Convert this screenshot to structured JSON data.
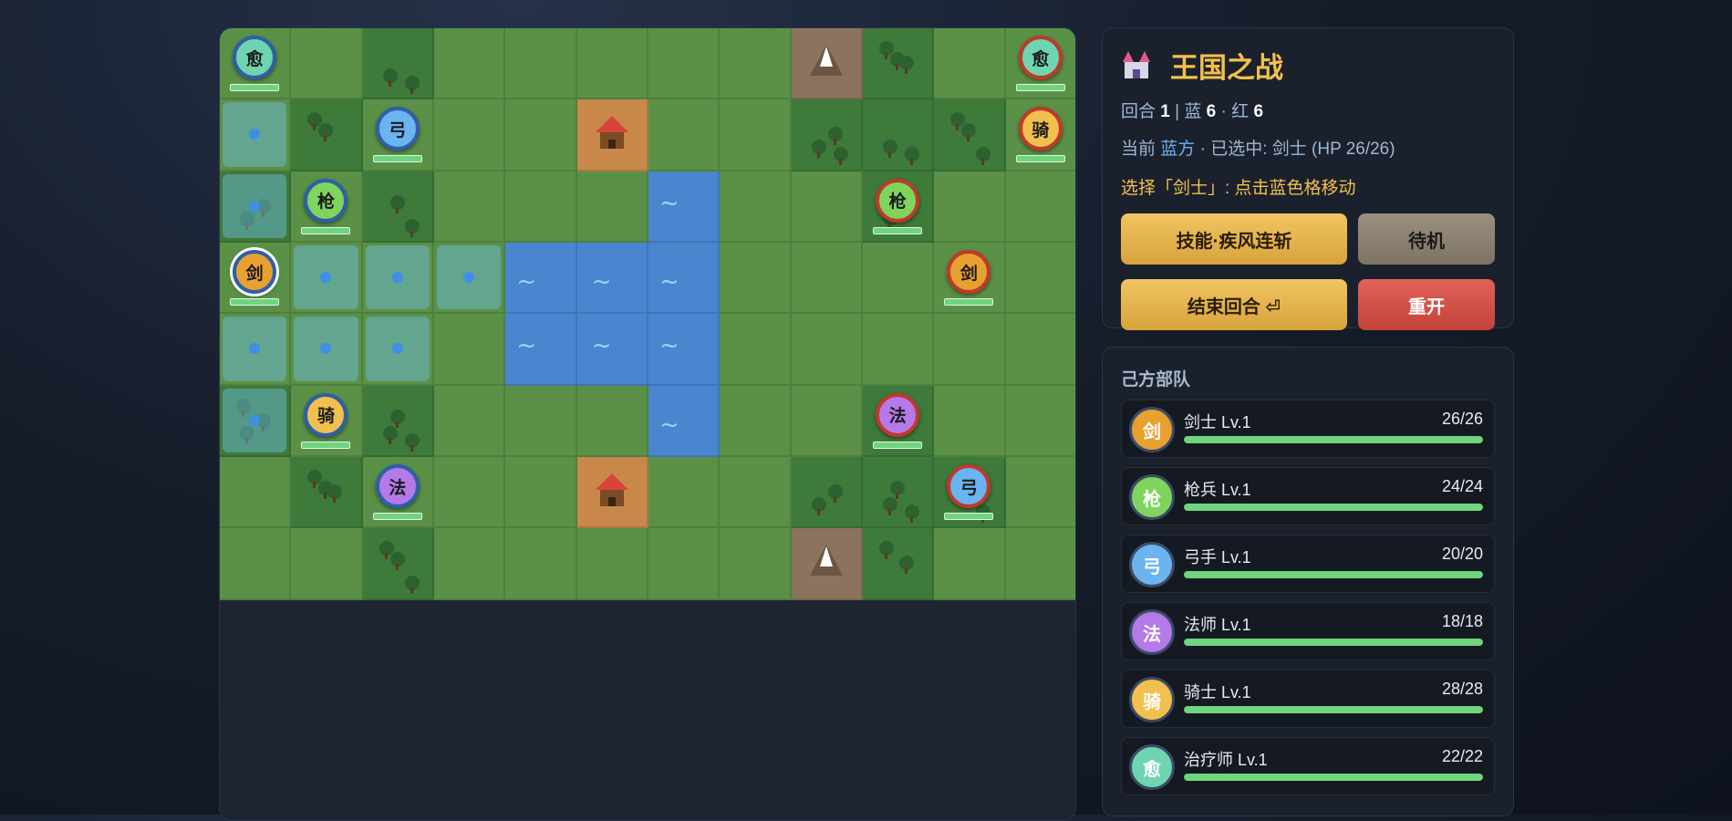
{
  "game": {
    "title": "王国之战",
    "turn_label": "回合",
    "turn": "1",
    "separator": "|",
    "blue_label": "蓝",
    "blue_count": "6",
    "dot": "·",
    "red_label": "红",
    "red_count": "6",
    "current_label": "当前",
    "current_side": "蓝方",
    "selected_label": "· 已选中: 剑士 (HP 26/26)",
    "hint": "选择「剑士」: 点击蓝色格移动"
  },
  "buttons": {
    "skill": "技能·疾风连斩",
    "wait": "待机",
    "end_turn": "结束回合 ⏎",
    "restart": "重开"
  },
  "colors": {
    "sword": "#e8a030",
    "spear": "#7fd45e",
    "bow": "#6ab4f0",
    "mage": "#b47ae8",
    "knight": "#f2c04e",
    "healer": "#6fd4b0"
  },
  "board": {
    "rows": [
      [
        "grass",
        "grass",
        "forest",
        "grass",
        "grass",
        "grass",
        "grass",
        "grass",
        "mountain",
        "forest",
        "grass",
        "grass"
      ],
      [
        "grass",
        "forest",
        "grass",
        "grass",
        "grass",
        "village",
        "grass",
        "grass",
        "forest",
        "forest",
        "forest",
        "grass"
      ],
      [
        "forest",
        "grass",
        "forest",
        "grass",
        "grass",
        "grass",
        "water",
        "grass",
        "grass",
        "forest",
        "grass",
        "grass"
      ],
      [
        "grass",
        "grass",
        "grass",
        "grass",
        "water",
        "water",
        "water",
        "grass",
        "grass",
        "grass",
        "grass",
        "grass"
      ],
      [
        "grass",
        "grass",
        "grass",
        "grass",
        "water",
        "water",
        "water",
        "grass",
        "grass",
        "grass",
        "grass",
        "grass"
      ],
      [
        "forest",
        "grass",
        "forest",
        "grass",
        "grass",
        "grass",
        "water",
        "grass",
        "grass",
        "forest",
        "grass",
        "grass"
      ],
      [
        "grass",
        "forest",
        "grass",
        "grass",
        "grass",
        "village",
        "grass",
        "grass",
        "forest",
        "forest",
        "forest",
        "grass"
      ],
      [
        "grass",
        "grass",
        "forest",
        "grass",
        "grass",
        "grass",
        "grass",
        "grass",
        "mountain",
        "forest",
        "grass",
        "grass"
      ]
    ],
    "highlights": [
      [
        1,
        0
      ],
      [
        2,
        0
      ],
      [
        3,
        1
      ],
      [
        3,
        2
      ],
      [
        3,
        3
      ],
      [
        4,
        0
      ],
      [
        4,
        1
      ],
      [
        4,
        2
      ],
      [
        5,
        0
      ]
    ],
    "units": [
      {
        "r": 0,
        "c": 0,
        "team": "blue",
        "glyph": "愈",
        "kind": "healer",
        "hp": 1
      },
      {
        "r": 1,
        "c": 2,
        "team": "blue",
        "glyph": "弓",
        "kind": "bow",
        "hp": 1
      },
      {
        "r": 2,
        "c": 1,
        "team": "blue",
        "glyph": "枪",
        "kind": "spear",
        "hp": 1
      },
      {
        "r": 3,
        "c": 0,
        "team": "blue",
        "glyph": "剑",
        "kind": "sword",
        "hp": 1,
        "selected": true
      },
      {
        "r": 5,
        "c": 1,
        "team": "blue",
        "glyph": "骑",
        "kind": "knight",
        "hp": 1
      },
      {
        "r": 6,
        "c": 2,
        "team": "blue",
        "glyph": "法",
        "kind": "mage",
        "hp": 1
      },
      {
        "r": 0,
        "c": 11,
        "team": "red",
        "glyph": "愈",
        "kind": "healer",
        "hp": 1
      },
      {
        "r": 1,
        "c": 11,
        "team": "red",
        "glyph": "骑",
        "kind": "knight",
        "hp": 1
      },
      {
        "r": 2,
        "c": 9,
        "team": "red",
        "glyph": "枪",
        "kind": "spear",
        "hp": 1
      },
      {
        "r": 3,
        "c": 10,
        "team": "red",
        "glyph": "剑",
        "kind": "sword",
        "hp": 1
      },
      {
        "r": 5,
        "c": 9,
        "team": "red",
        "glyph": "法",
        "kind": "mage",
        "hp": 1
      },
      {
        "r": 6,
        "c": 10,
        "team": "red",
        "glyph": "弓",
        "kind": "bow",
        "hp": 1
      }
    ]
  },
  "roster": {
    "title": "己方部队",
    "units": [
      {
        "glyph": "剑",
        "name": "剑士 Lv.1",
        "hp": "26/26",
        "kind": "sword",
        "fill": 1
      },
      {
        "glyph": "枪",
        "name": "枪兵 Lv.1",
        "hp": "24/24",
        "kind": "spear",
        "fill": 1
      },
      {
        "glyph": "弓",
        "name": "弓手 Lv.1",
        "hp": "20/20",
        "kind": "bow",
        "fill": 1
      },
      {
        "glyph": "法",
        "name": "法师 Lv.1",
        "hp": "18/18",
        "kind": "mage",
        "fill": 1
      },
      {
        "glyph": "骑",
        "name": "骑士 Lv.1",
        "hp": "28/28",
        "kind": "knight",
        "fill": 1
      },
      {
        "glyph": "愈",
        "name": "治疗师 Lv.1",
        "hp": "22/22",
        "kind": "healer",
        "fill": 1
      }
    ]
  }
}
